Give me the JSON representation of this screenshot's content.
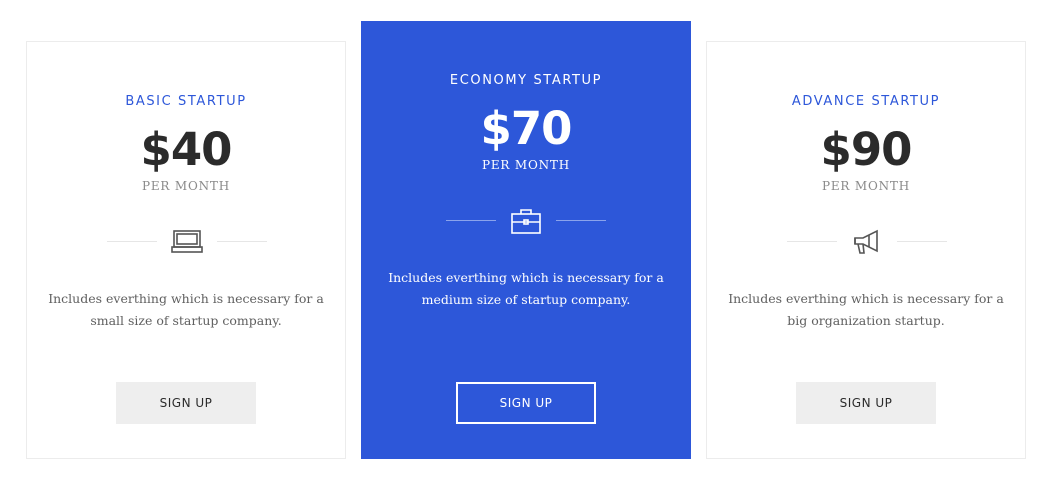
{
  "plans": [
    {
      "name": "BASIC STARTUP",
      "price": "$40",
      "period": "PER MONTH",
      "icon": "laptop-icon",
      "description": "Includes everthing which is necessary for a small size of startup company.",
      "button_label": "SIGN UP"
    },
    {
      "name": "ECONOMY STARTUP",
      "price": "$70",
      "period": "PER MONTH",
      "icon": "briefcase-icon",
      "description": "Includes everthing which is necessary for a medium size of startup company.",
      "button_label": "SIGN UP",
      "featured": true
    },
    {
      "name": "ADVANCE STARTUP",
      "price": "$90",
      "period": "PER MONTH",
      "icon": "megaphone-icon",
      "description": "Includes everthing which is necessary for a big organization startup.",
      "button_label": "SIGN UP"
    }
  ],
  "colors": {
    "accent": "#2d57d9",
    "text_dark": "#2b2b2b",
    "text_muted": "#8a8a8a",
    "button_bg": "#eeeeee"
  }
}
